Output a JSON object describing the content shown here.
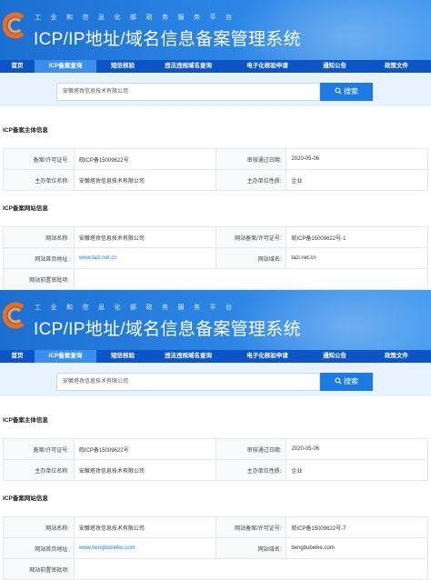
{
  "shots": [
    {
      "header": {
        "subtitle": "工业和信息化部政务服务平台",
        "title": "ICP/IP地址/域名信息备案管理系统"
      },
      "nav": [
        "首页",
        "ICP备案查询",
        "短信核验",
        "违法违规域名查询",
        "电子化核验申请",
        "通知公告",
        "政策文件"
      ],
      "search": {
        "value": "安徽塔孜信息技术有限公司",
        "button": "搜索"
      },
      "subject": {
        "title": "ICP备案主体信息",
        "row1": {
          "l1": "备案/许可证号:",
          "v1": "皖ICP备15009622号",
          "l2": "审核通过日期:",
          "v2": "2020-05-06"
        },
        "row2": {
          "l1": "主办单位名称:",
          "v1": "安徽塔孜信息技术有限公司",
          "l2": "主办单位性质:",
          "v2": "企业"
        }
      },
      "website": {
        "title": "ICP备案网站信息",
        "row1": {
          "l1": "网站名称:",
          "v1": "安徽塔孜信息技术有限公司",
          "l2": "网站备案/许可证号:",
          "v2": "皖ICP备15009622号-1"
        },
        "row2": {
          "l1": "网站首页地址:",
          "v1": "www.tazi.net.cn",
          "l2": "网站域名:",
          "v2": "tazi.net.cn"
        },
        "row3": {
          "l1": "网站前置审批项:"
        }
      }
    },
    {
      "header": {
        "subtitle": "工业和信息化部政务服务平台",
        "title": "ICP/IP地址/域名信息备案管理系统"
      },
      "nav": [
        "首页",
        "ICP备案查询",
        "短信核验",
        "违法违规域名查询",
        "电子化核验申请",
        "通知公告",
        "政策文件"
      ],
      "search": {
        "value": "安徽塔孜信息技术有限公司",
        "button": "搜索"
      },
      "subject": {
        "title": "ICP备案主体信息",
        "row1": {
          "l1": "备案/许可证号:",
          "v1": "皖ICP备15009622号",
          "l2": "审核通过日期:",
          "v2": "2020-05-06"
        },
        "row2": {
          "l1": "主办单位名称:",
          "v1": "安徽塔孜信息技术有限公司",
          "l2": "主办单位性质:",
          "v2": "企业"
        }
      },
      "website": {
        "title": "ICP备案网站信息",
        "row1": {
          "l1": "网站名称:",
          "v1": "安徽塔孜信息技术有限公司",
          "l2": "网站备案/许可证号:",
          "v2": "皖ICP备15009622号-7"
        },
        "row2": {
          "l1": "网站首页地址:",
          "v1": "www.bengbubeike.com",
          "l2": "网站域名:",
          "v2": "bengbubeike.com"
        },
        "row3": {
          "l1": "网站前置审批项:"
        }
      }
    }
  ],
  "colors": {
    "banner": "#1b6fd1",
    "nav": "#0d55c4",
    "nav_active": "#3c8fe9",
    "search_button": "#1e7be3",
    "link": "#1e7be3"
  },
  "icons": {
    "logo": "miit-emblem-icon",
    "search": "search-icon"
  }
}
